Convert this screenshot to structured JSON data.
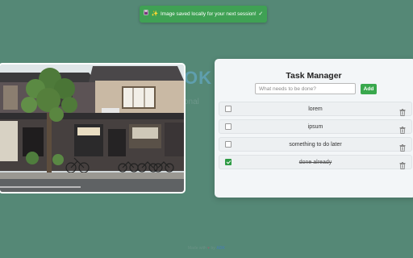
{
  "toast": {
    "text": "Image saved locally for your next session!",
    "lead_icons": [
      "save-icon",
      "sparkles-icon"
    ],
    "trail_icon": "check-icon",
    "color": "#3fa154"
  },
  "background_page": {
    "heading": "OK",
    "subheading": "onal",
    "footer_prefix": "Made with",
    "footer_by": "by",
    "footer_brand": "ADK"
  },
  "task_manager": {
    "title": "Task Manager",
    "input_placeholder": "What needs to be done?",
    "add_label": "Add",
    "accent": "#39a84d",
    "tasks": [
      {
        "text": "lorem",
        "done": false
      },
      {
        "text": "ipsum",
        "done": false
      },
      {
        "text": "something to do later",
        "done": false
      },
      {
        "text": "done already",
        "done": true
      }
    ]
  }
}
